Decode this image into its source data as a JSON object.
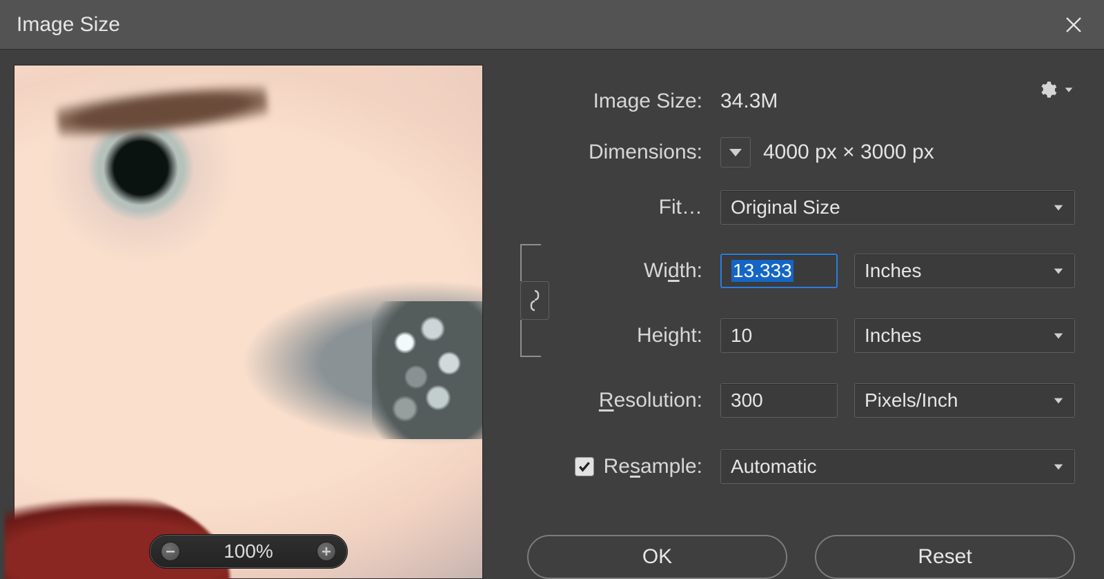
{
  "dialog": {
    "title": "Image Size"
  },
  "preview": {
    "zoom": "100%"
  },
  "info": {
    "image_size_label": "Image Size:",
    "image_size_value": "34.3M",
    "dimensions_label": "Dimensions:",
    "dimensions_value": "4000 px  ×  3000 px"
  },
  "fit": {
    "label": "Fit…",
    "selected": "Original Size"
  },
  "width": {
    "label_pre": "Wi",
    "label_ul": "d",
    "label_post": "th:",
    "value": "13.333",
    "unit": "Inches"
  },
  "height": {
    "label_pre": "Hei",
    "label_ul": "g",
    "label_post": "ht:",
    "value": "10",
    "unit": "Inches"
  },
  "resolution": {
    "label_ul": "R",
    "label_post": "esolution:",
    "value": "300",
    "unit": "Pixels/Inch"
  },
  "resample": {
    "checked": true,
    "label_pre": "Re",
    "label_ul": "s",
    "label_post": "ample:",
    "selected": "Automatic"
  },
  "buttons": {
    "ok": "OK",
    "reset": "Reset"
  }
}
